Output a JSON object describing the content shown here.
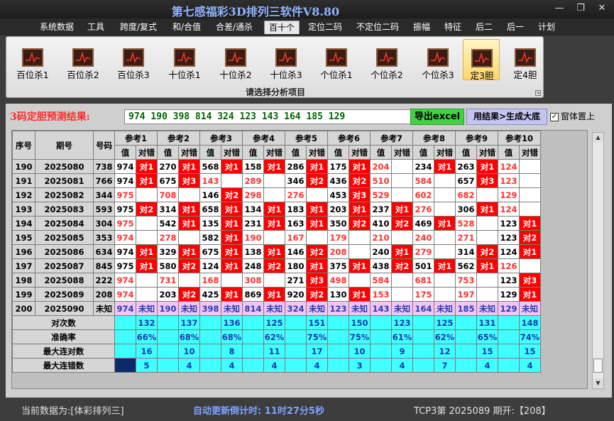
{
  "window": {
    "title": "第七感福彩3D排列三软件V8.80",
    "min": "—",
    "max": "❐",
    "close": "✕"
  },
  "menu": [
    "系统数据",
    "工具",
    "跨度/复式",
    "和/合值",
    "合差/通杀",
    "百十个",
    "定位二码",
    "不定位二码",
    "振幅",
    "特征",
    "后二",
    "后一",
    "计划"
  ],
  "menu_active": 5,
  "ribbon": {
    "buttons": [
      "百位杀1",
      "百位杀2",
      "百位杀3",
      "十位杀1",
      "十位杀2",
      "十位杀3",
      "个位杀1",
      "个位杀2",
      "个位杀3",
      "定3胆",
      "定4胆"
    ],
    "selected": 9,
    "caption": "请选择分析项目"
  },
  "result": {
    "label": "3码定胆预测结果:",
    "value": "974 190 398 814 324 123 143 164 185 129",
    "export_btn": "导出excel",
    "gen_btn": "用结果>生成大底",
    "ontop_label": "窗体置上",
    "ontop_checked": "✓"
  },
  "table": {
    "h_seq": "序号",
    "h_period": "期号",
    "h_num": "号码",
    "h_val": "值",
    "h_hit": "对错",
    "refs": [
      "参考1",
      "参考2",
      "参考3",
      "参考4",
      "参考5",
      "参考6",
      "参考7",
      "参考8",
      "参考9",
      "参考10"
    ],
    "rows": [
      {
        "seq": "190",
        "period": "2025080",
        "num": "738",
        "cells": [
          [
            "974",
            "对1"
          ],
          [
            "270",
            "对1"
          ],
          [
            "568",
            "对1"
          ],
          [
            "158",
            "对1"
          ],
          [
            "286",
            "对1"
          ],
          [
            "175",
            "对1"
          ],
          [
            "204",
            ""
          ],
          [
            "234",
            "对1"
          ],
          [
            "263",
            "对1"
          ],
          [
            "124",
            ""
          ]
        ]
      },
      {
        "seq": "191",
        "period": "2025081",
        "num": "766",
        "cells": [
          [
            "974",
            "对1"
          ],
          [
            "675",
            "对3"
          ],
          [
            "143",
            ""
          ],
          [
            "289",
            ""
          ],
          [
            "346",
            "对2"
          ],
          [
            "436",
            "对2"
          ],
          [
            "510",
            ""
          ],
          [
            "584",
            ""
          ],
          [
            "657",
            "对3"
          ],
          [
            "123",
            ""
          ]
        ]
      },
      {
        "seq": "192",
        "period": "2025082",
        "num": "344",
        "cells": [
          [
            "975",
            ""
          ],
          [
            "708",
            ""
          ],
          [
            "146",
            "对2"
          ],
          [
            "298",
            ""
          ],
          [
            "276",
            ""
          ],
          [
            "453",
            "对3"
          ],
          [
            "529",
            ""
          ],
          [
            "602",
            ""
          ],
          [
            "682",
            ""
          ],
          [
            "129",
            ""
          ]
        ]
      },
      {
        "seq": "193",
        "period": "2025083",
        "num": "593",
        "cells": [
          [
            "975",
            "对2"
          ],
          [
            "314",
            "对1"
          ],
          [
            "658",
            "对1"
          ],
          [
            "134",
            "对1"
          ],
          [
            "183",
            "对1"
          ],
          [
            "203",
            "对1"
          ],
          [
            "237",
            "对1"
          ],
          [
            "276",
            ""
          ],
          [
            "306",
            "对1"
          ],
          [
            "124",
            ""
          ]
        ]
      },
      {
        "seq": "194",
        "period": "2025084",
        "num": "304",
        "cells": [
          [
            "975",
            ""
          ],
          [
            "542",
            "对1"
          ],
          [
            "135",
            "对1"
          ],
          [
            "231",
            "对1"
          ],
          [
            "163",
            "对1"
          ],
          [
            "350",
            "对2"
          ],
          [
            "410",
            "对2"
          ],
          [
            "469",
            "对1"
          ],
          [
            "528",
            ""
          ],
          [
            "123",
            "对1"
          ]
        ]
      },
      {
        "seq": "195",
        "period": "2025085",
        "num": "353",
        "cells": [
          [
            "974",
            ""
          ],
          [
            "278",
            ""
          ],
          [
            "582",
            "对1"
          ],
          [
            "190",
            ""
          ],
          [
            "167",
            ""
          ],
          [
            "179",
            ""
          ],
          [
            "210",
            ""
          ],
          [
            "240",
            ""
          ],
          [
            "271",
            ""
          ],
          [
            "123",
            "对2"
          ]
        ]
      },
      {
        "seq": "196",
        "period": "2025086",
        "num": "634",
        "cells": [
          [
            "974",
            "对1"
          ],
          [
            "329",
            "对1"
          ],
          [
            "675",
            "对1"
          ],
          [
            "138",
            "对1"
          ],
          [
            "146",
            "对2"
          ],
          [
            "208",
            ""
          ],
          [
            "240",
            "对1"
          ],
          [
            "279",
            ""
          ],
          [
            "314",
            "对2"
          ],
          [
            "124",
            "对1"
          ]
        ]
      },
      {
        "seq": "197",
        "period": "2025087",
        "num": "845",
        "cells": [
          [
            "975",
            "对1"
          ],
          [
            "580",
            "对2"
          ],
          [
            "124",
            "对1"
          ],
          [
            "248",
            "对2"
          ],
          [
            "180",
            "对1"
          ],
          [
            "375",
            "对1"
          ],
          [
            "438",
            "对2"
          ],
          [
            "501",
            "对1"
          ],
          [
            "562",
            "对1"
          ],
          [
            "126",
            ""
          ]
        ]
      },
      {
        "seq": "198",
        "period": "2025088",
        "num": "222",
        "cells": [
          [
            "974",
            ""
          ],
          [
            "731",
            ""
          ],
          [
            "168",
            ""
          ],
          [
            "308",
            ""
          ],
          [
            "271",
            "对3"
          ],
          [
            "498",
            ""
          ],
          [
            "584",
            ""
          ],
          [
            "681",
            ""
          ],
          [
            "753",
            ""
          ],
          [
            "123",
            "对3"
          ]
        ]
      },
      {
        "seq": "199",
        "period": "2025089",
        "num": "208",
        "cells": [
          [
            "974",
            ""
          ],
          [
            "203",
            "对2"
          ],
          [
            "425",
            "对1"
          ],
          [
            "869",
            "对1"
          ],
          [
            "920",
            "对2"
          ],
          [
            "130",
            "对1"
          ],
          [
            "153",
            ""
          ],
          [
            "175",
            ""
          ],
          [
            "197",
            ""
          ],
          [
            "129",
            "对1"
          ]
        ]
      },
      {
        "seq": "200",
        "period": "2025090",
        "num": "未知",
        "cells": [
          [
            "974",
            "未知"
          ],
          [
            "190",
            "未知"
          ],
          [
            "398",
            "未知"
          ],
          [
            "814",
            "未知"
          ],
          [
            "324",
            "未知"
          ],
          [
            "123",
            "未知"
          ],
          [
            "143",
            "未知"
          ],
          [
            "164",
            "未知"
          ],
          [
            "185",
            "未知"
          ],
          [
            "129",
            "未知"
          ]
        ]
      }
    ],
    "stats": [
      {
        "label": "对次数",
        "values": [
          "132",
          "137",
          "136",
          "125",
          "151",
          "150",
          "123",
          "125",
          "131",
          "148"
        ]
      },
      {
        "label": "准确率",
        "values": [
          "66%",
          "68%",
          "68%",
          "62%",
          "75%",
          "75%",
          "61%",
          "62%",
          "65%",
          "74%"
        ]
      },
      {
        "label": "最大连对数",
        "values": [
          "16",
          "10",
          "8",
          "11",
          "17",
          "10",
          "9",
          "12",
          "15",
          "15"
        ]
      },
      {
        "label": "最大连错数",
        "values": [
          "5",
          "4",
          "4",
          "4",
          "4",
          "3",
          "4",
          "7",
          "4",
          "4"
        ]
      }
    ]
  },
  "status": {
    "source": "当前数据为:[体彩排列三]",
    "countdown": "自动更新倒计时: 11时27分5秒",
    "issue": "TCP3第 2025089 期开:【208】"
  },
  "colors": {
    "hit": "#ff0000",
    "miss_value": "#ff3030",
    "forecast_row": "#f4c4f4",
    "stats_bg": "#40ffff",
    "result_text": "#006600",
    "title": "#8fb2ff",
    "label_red": "#ff2a2a"
  }
}
